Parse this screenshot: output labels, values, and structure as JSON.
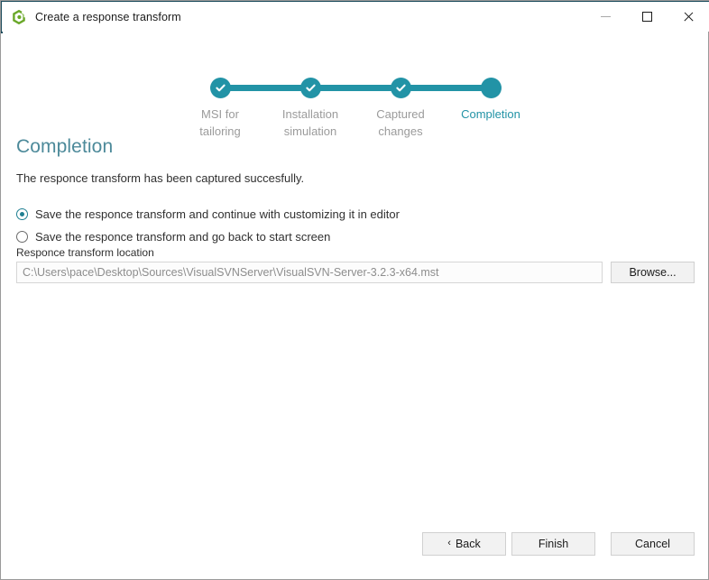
{
  "window": {
    "title": "Create a response transform",
    "app_icon": "pace-suite-icon",
    "accent_color": "#1b4b5c",
    "controls": {
      "minimize": "minimize-icon",
      "maximize": "maximize-icon",
      "close": "close-icon"
    }
  },
  "stepper": {
    "accent_color": "#2293a6",
    "inactive_label_color": "#9b9b9b",
    "steps": [
      {
        "label": "MSI for\ntailoring",
        "state": "completed",
        "icon": "check-icon"
      },
      {
        "label": "Installation\nsimulation",
        "state": "completed",
        "icon": "check-icon"
      },
      {
        "label": "Captured\nchanges",
        "state": "completed",
        "icon": "check-icon"
      },
      {
        "label": "Completion",
        "state": "active",
        "icon": ""
      }
    ]
  },
  "main": {
    "heading": "Completion",
    "description": "The responce transform has been captured succesfully.",
    "options": [
      {
        "label": "Save the responce transform and continue with customizing it in editor",
        "selected": true
      },
      {
        "label": "Save the responce transform and go back to start screen",
        "selected": false
      }
    ],
    "location": {
      "label": "Responce transform location",
      "value": "C:\\Users\\pace\\Desktop\\Sources\\VisualSVNServer\\VisualSVN-Server-3.2.3-x64.mst",
      "placeholder": "",
      "browse_label": "Browse..."
    }
  },
  "footer": {
    "back_label": "Back",
    "back_chevron": "‹",
    "finish_label": "Finish",
    "cancel_label": "Cancel"
  }
}
